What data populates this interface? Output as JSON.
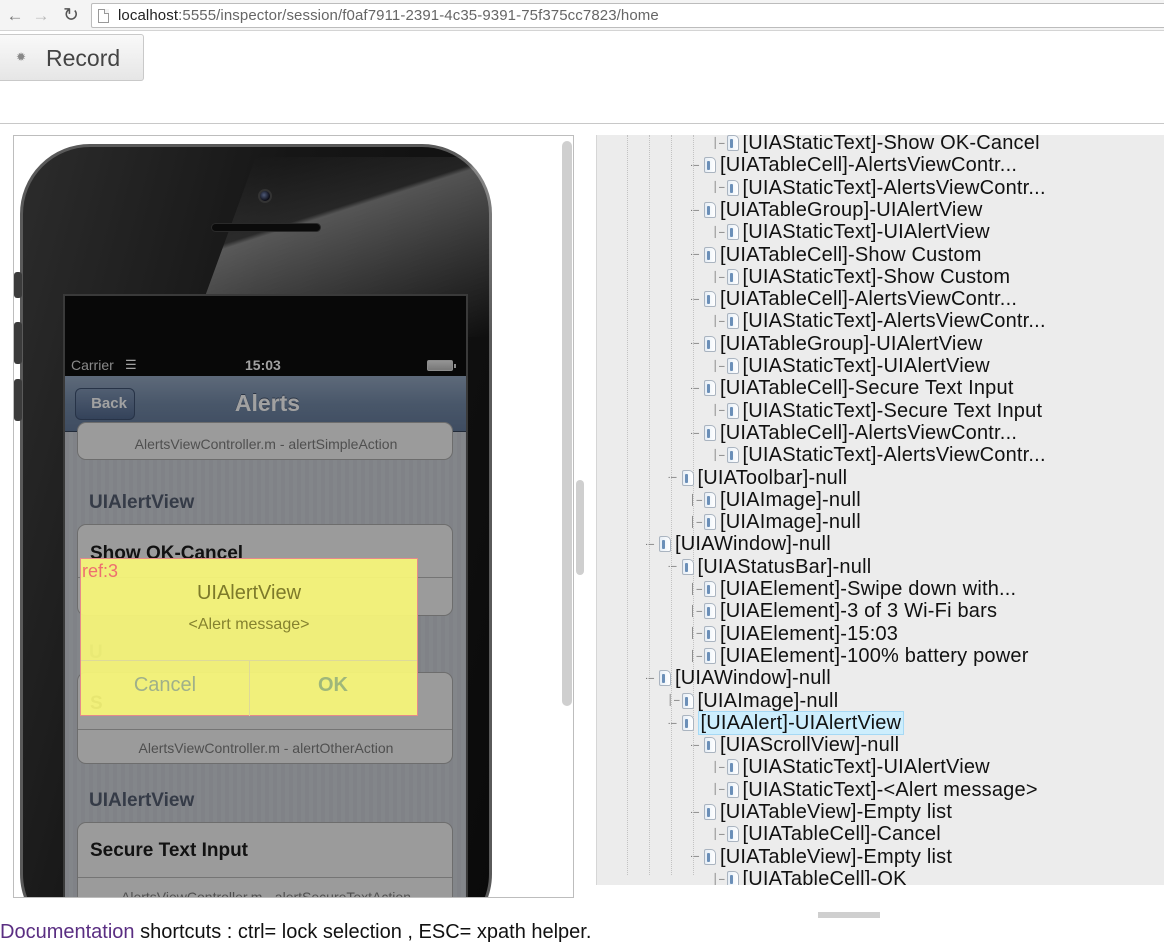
{
  "browser": {
    "url_host": "localhost",
    "url_path": ":5555/inspector/session/f0af7911-2391-4c35-9391-75f375cc7823/home"
  },
  "toolbar": {
    "record_label": "Record"
  },
  "device": {
    "status_bar": {
      "carrier": "Carrier",
      "time": "15:03"
    },
    "navbar": {
      "back_label": "Back",
      "title": "Alerts"
    },
    "cells": {
      "top_sub": "AlertsViewController.m - alertSimpleAction",
      "group1_header": "UIAlertView",
      "show_ok_cancel": "Show OK-Cancel",
      "group2_header_partial": "U",
      "show_custom_partial": "S",
      "other_sub": "AlertsViewController.m - alertOtherAction",
      "group3_header": "UIAlertView",
      "secure_text_input": "Secure Text Input",
      "secure_sub": "AlertsViewController.m - alertSecureTextAction"
    },
    "alert": {
      "ref": "ref:3",
      "title": "UIAlertView",
      "message": "<Alert message>",
      "cancel": "Cancel",
      "ok": "OK"
    }
  },
  "tree": {
    "nodes": [
      {
        "label": "[UIAStaticText]-Show OK-Cancel",
        "depth": 3,
        "toggle": false
      },
      {
        "label": "[UIATableCell]-AlertsViewContr...",
        "depth": 2,
        "toggle": true
      },
      {
        "label": "[UIAStaticText]-AlertsViewContr...",
        "depth": 3,
        "toggle": false
      },
      {
        "label": "[UIATableGroup]-UIAlertView",
        "depth": 2,
        "toggle": true
      },
      {
        "label": "[UIAStaticText]-UIAlertView",
        "depth": 3,
        "toggle": false
      },
      {
        "label": "[UIATableCell]-Show Custom",
        "depth": 2,
        "toggle": true
      },
      {
        "label": "[UIAStaticText]-Show Custom",
        "depth": 3,
        "toggle": false
      },
      {
        "label": "[UIATableCell]-AlertsViewContr...",
        "depth": 2,
        "toggle": true
      },
      {
        "label": "[UIAStaticText]-AlertsViewContr...",
        "depth": 3,
        "toggle": false
      },
      {
        "label": "[UIATableGroup]-UIAlertView",
        "depth": 2,
        "toggle": true
      },
      {
        "label": "[UIAStaticText]-UIAlertView",
        "depth": 3,
        "toggle": false
      },
      {
        "label": "[UIATableCell]-Secure Text Input",
        "depth": 2,
        "toggle": true
      },
      {
        "label": "[UIAStaticText]-Secure Text Input",
        "depth": 3,
        "toggle": false
      },
      {
        "label": "[UIATableCell]-AlertsViewContr...",
        "depth": 2,
        "toggle": true
      },
      {
        "label": "[UIAStaticText]-AlertsViewContr...",
        "depth": 3,
        "toggle": false
      },
      {
        "label": "[UIAToolbar]-null",
        "depth": 1,
        "toggle": true
      },
      {
        "label": "[UIAImage]-null",
        "depth": 2,
        "toggle": false
      },
      {
        "label": "[UIAImage]-null",
        "depth": 2,
        "toggle": false
      },
      {
        "label": "[UIAWindow]-null",
        "depth": 0,
        "toggle": true
      },
      {
        "label": "[UIAStatusBar]-null",
        "depth": 1,
        "toggle": true
      },
      {
        "label": "[UIAElement]-Swipe down with...",
        "depth": 2,
        "toggle": false
      },
      {
        "label": "[UIAElement]-3 of 3 Wi-Fi bars",
        "depth": 2,
        "toggle": false
      },
      {
        "label": "[UIAElement]-15:03",
        "depth": 2,
        "toggle": false
      },
      {
        "label": "[UIAElement]-100% battery power",
        "depth": 2,
        "toggle": false
      },
      {
        "label": "[UIAWindow]-null",
        "depth": 0,
        "toggle": true
      },
      {
        "label": "[UIAImage]-null",
        "depth": 1,
        "toggle": false
      },
      {
        "label": "[UIAAlert]-UIAlertView",
        "depth": 1,
        "toggle": true,
        "selected": true
      },
      {
        "label": "[UIAScrollView]-null",
        "depth": 2,
        "toggle": true
      },
      {
        "label": "[UIAStaticText]-UIAlertView",
        "depth": 3,
        "toggle": false
      },
      {
        "label": "[UIAStaticText]-<Alert message>",
        "depth": 3,
        "toggle": false
      },
      {
        "label": "[UIATableView]-Empty list",
        "depth": 2,
        "toggle": true
      },
      {
        "label": "[UIATableCell]-Cancel",
        "depth": 3,
        "toggle": false
      },
      {
        "label": "[UIATableView]-Empty list",
        "depth": 2,
        "toggle": true
      },
      {
        "label": "[UIATableCell]-OK",
        "depth": 3,
        "toggle": false
      }
    ]
  },
  "footer": {
    "doc_link": "Documentation",
    "shortcuts_text": " shortcuts : ctrl= lock selection , ESC= xpath helper."
  },
  "colors": {
    "alert_fill": "#f8f678",
    "selection": "#cdeefd",
    "link": "#5a2e82"
  }
}
